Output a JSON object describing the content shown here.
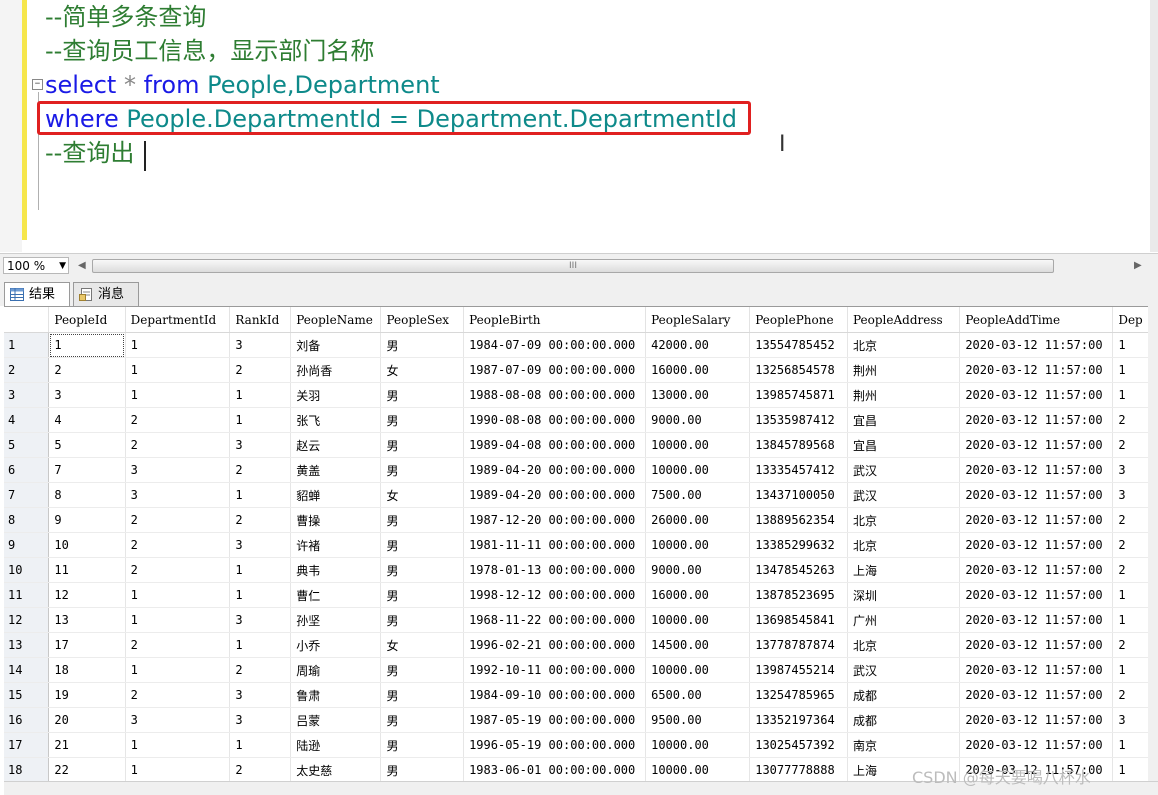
{
  "editor": {
    "line1": "--简单多条查询",
    "line2": "--查询员工信息，显示部门名称",
    "line3_kw1": "select",
    "line3_star": "*",
    "line3_kw2": "from",
    "line3_rest": "People,Department",
    "line4_kw": "where",
    "line4_rest": "People.DepartmentId = Department.DepartmentId",
    "line5": "--查询出",
    "ibeam": "I"
  },
  "zoom": {
    "value": "100 %"
  },
  "scroll_grip": "III",
  "tabs": [
    {
      "label": "结果"
    },
    {
      "label": "消息"
    }
  ],
  "grid": {
    "columns": [
      "PeopleId",
      "DepartmentId",
      "RankId",
      "PeopleName",
      "PeopleSex",
      "PeopleBirth",
      "PeopleSalary",
      "PeoplePhone",
      "PeopleAddress",
      "PeopleAddTime",
      "Dep"
    ],
    "rows": [
      [
        "1",
        "1",
        "1",
        "3",
        "刘备",
        "男",
        "1984-07-09 00:00:00.000",
        "42000.00",
        "13554785452",
        "北京",
        "2020-03-12 11:57:00",
        "1"
      ],
      [
        "2",
        "2",
        "1",
        "2",
        "孙尚香",
        "女",
        "1987-07-09 00:00:00.000",
        "16000.00",
        "13256854578",
        "荆州",
        "2020-03-12 11:57:00",
        "1"
      ],
      [
        "3",
        "3",
        "1",
        "1",
        "关羽",
        "男",
        "1988-08-08 00:00:00.000",
        "13000.00",
        "13985745871",
        "荆州",
        "2020-03-12 11:57:00",
        "1"
      ],
      [
        "4",
        "4",
        "2",
        "1",
        "张飞",
        "男",
        "1990-08-08 00:00:00.000",
        "9000.00",
        "13535987412",
        "宜昌",
        "2020-03-12 11:57:00",
        "2"
      ],
      [
        "5",
        "5",
        "2",
        "3",
        "赵云",
        "男",
        "1989-04-08 00:00:00.000",
        "10000.00",
        "13845789568",
        "宜昌",
        "2020-03-12 11:57:00",
        "2"
      ],
      [
        "6",
        "7",
        "3",
        "2",
        "黄盖",
        "男",
        "1989-04-20 00:00:00.000",
        "10000.00",
        "13335457412",
        "武汉",
        "2020-03-12 11:57:00",
        "3"
      ],
      [
        "7",
        "8",
        "3",
        "1",
        "貂蝉",
        "女",
        "1989-04-20 00:00:00.000",
        "7500.00",
        "13437100050",
        "武汉",
        "2020-03-12 11:57:00",
        "3"
      ],
      [
        "8",
        "9",
        "2",
        "2",
        "曹操",
        "男",
        "1987-12-20 00:00:00.000",
        "26000.00",
        "13889562354",
        "北京",
        "2020-03-12 11:57:00",
        "2"
      ],
      [
        "9",
        "10",
        "2",
        "3",
        "许褚",
        "男",
        "1981-11-11 00:00:00.000",
        "10000.00",
        "13385299632",
        "北京",
        "2020-03-12 11:57:00",
        "2"
      ],
      [
        "10",
        "11",
        "2",
        "1",
        "典韦",
        "男",
        "1978-01-13 00:00:00.000",
        "9000.00",
        "13478545263",
        "上海",
        "2020-03-12 11:57:00",
        "2"
      ],
      [
        "11",
        "12",
        "1",
        "1",
        "曹仁",
        "男",
        "1998-12-12 00:00:00.000",
        "16000.00",
        "13878523695",
        "深圳",
        "2020-03-12 11:57:00",
        "1"
      ],
      [
        "12",
        "13",
        "1",
        "3",
        "孙坚",
        "男",
        "1968-11-22 00:00:00.000",
        "10000.00",
        "13698545841",
        "广州",
        "2020-03-12 11:57:00",
        "1"
      ],
      [
        "13",
        "17",
        "2",
        "1",
        "小乔",
        "女",
        "1996-02-21 00:00:00.000",
        "14500.00",
        "13778787874",
        "北京",
        "2020-03-12 11:57:00",
        "2"
      ],
      [
        "14",
        "18",
        "1",
        "2",
        "周瑜",
        "男",
        "1992-10-11 00:00:00.000",
        "10000.00",
        "13987455214",
        "武汉",
        "2020-03-12 11:57:00",
        "1"
      ],
      [
        "15",
        "19",
        "2",
        "3",
        "鲁肃",
        "男",
        "1984-09-10 00:00:00.000",
        "6500.00",
        "13254785965",
        "成都",
        "2020-03-12 11:57:00",
        "2"
      ],
      [
        "16",
        "20",
        "3",
        "3",
        "吕蒙",
        "男",
        "1987-05-19 00:00:00.000",
        "9500.00",
        "13352197364",
        "成都",
        "2020-03-12 11:57:00",
        "3"
      ],
      [
        "17",
        "21",
        "1",
        "1",
        "陆逊",
        "男",
        "1996-05-19 00:00:00.000",
        "10000.00",
        "13025457392",
        "南京",
        "2020-03-12 11:57:00",
        "1"
      ],
      [
        "18",
        "22",
        "1",
        "2",
        "太史慈",
        "男",
        "1983-06-01 00:00:00.000",
        "10000.00",
        "13077778888",
        "上海",
        "2020-03-12 11:57:00",
        "1"
      ]
    ]
  },
  "watermark": "CSDN @每天要喝八杯水",
  "colors": {
    "highlight_box": "#e02020",
    "comment": "#2e7d32",
    "keyword": "#1a1ae6",
    "identifier": "#0e8a8a"
  }
}
